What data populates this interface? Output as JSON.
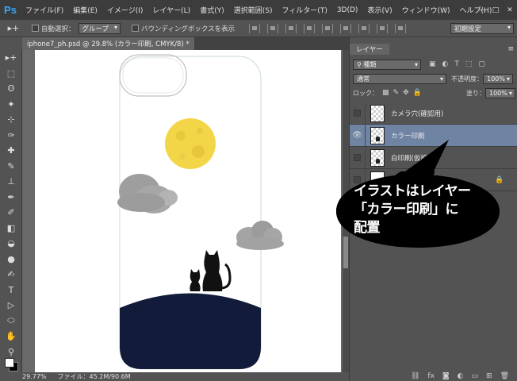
{
  "app": {
    "logo": "Ps"
  },
  "menu": [
    "ファイル(F)",
    "編集(E)",
    "イメージ(I)",
    "レイヤー(L)",
    "書式(Y)",
    "選択範囲(S)",
    "フィルター(T)",
    "3D(D)",
    "表示(V)",
    "ウィンドウ(W)",
    "ヘルプ(H)"
  ],
  "window_controls": {
    "minimize": "—",
    "maximize": "□",
    "close": "✕"
  },
  "options_bar": {
    "tool_glyph": "▸+",
    "auto_select_label": "自動選択：",
    "auto_select_value": "グループ",
    "bounding_box_label": "バウンディングボックスを表示",
    "workspace": "初期設定"
  },
  "document": {
    "tab_title": "iphone7_ph.psd @ 29.8% (カラー印刷, CMYK/8) *"
  },
  "status": {
    "zoom": "29.77%",
    "file_info": "ファイル：45.2M/90.6M"
  },
  "toolbar": {
    "tools": [
      "▸+",
      "⬚",
      "ʘ",
      "✦",
      "⊹",
      "✑",
      "✚",
      "✎",
      "⊥",
      "✒",
      "✐",
      "◧",
      "◒",
      "●",
      "✍",
      "T",
      "▷",
      "⬭",
      "✋",
      "⚲"
    ]
  },
  "colors": {
    "foreground": "#ffffff",
    "background": "#000000",
    "selected_layer": "#6f84a3",
    "ground": "#121b3a",
    "moon": "#f2d648"
  },
  "layers_panel": {
    "tab_label": "レイヤー",
    "menu_glyph": "≡",
    "filter_label": "種類",
    "blend_mode": "通常",
    "opacity_label": "不透明度：",
    "opacity_value": "100%",
    "lock_label": "ロック：",
    "fill_label": "塗り：",
    "fill_value": "100%",
    "filter_icons": [
      "▣",
      "◐",
      "T",
      "⬚",
      "▢"
    ],
    "lock_icons": [
      "▩",
      "✎",
      "✥",
      "🔒"
    ],
    "layers": [
      {
        "name": "カメラ穴(確認用)",
        "visible": false,
        "selected": false
      },
      {
        "name": "カラー印刷",
        "visible": true,
        "selected": true
      },
      {
        "name": "白印刷(仮設定)",
        "visible": false,
        "selected": false
      },
      {
        "name": "",
        "visible": false,
        "selected": false,
        "locked": true
      }
    ],
    "footer_icons": [
      "⛓",
      "fx",
      "◙",
      "◐",
      "▭",
      "⊞",
      "🗑"
    ]
  },
  "callout": {
    "lines": [
      "イラストはレイヤー",
      "「カラー印刷」に",
      "配置"
    ]
  }
}
